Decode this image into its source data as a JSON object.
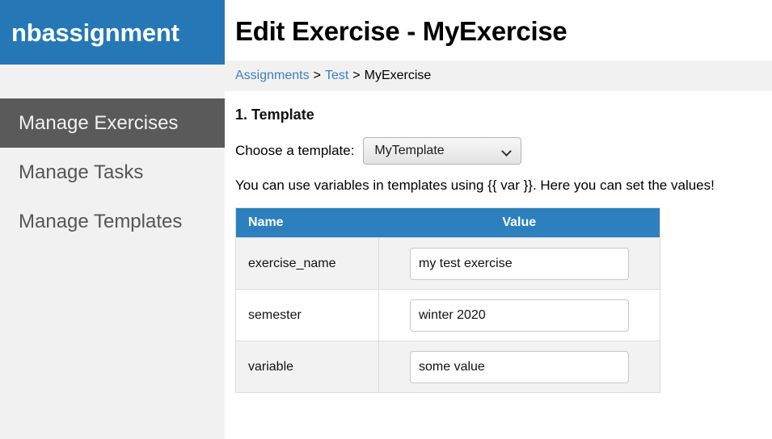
{
  "sidebar": {
    "brand": "nbassignment",
    "items": [
      {
        "label": "Manage Exercises",
        "active": true
      },
      {
        "label": "Manage Tasks",
        "active": false
      },
      {
        "label": "Manage Templates",
        "active": false
      }
    ]
  },
  "header": {
    "title": "Edit Exercise - MyExercise"
  },
  "breadcrumb": {
    "items": [
      {
        "label": "Assignments",
        "link": true
      },
      {
        "label": "Test",
        "link": true
      },
      {
        "label": "MyExercise",
        "link": false
      }
    ],
    "separator": ">"
  },
  "template_section": {
    "heading": "1. Template",
    "choose_label": "Choose a template:",
    "selected_template": "MyTemplate",
    "dropdown_icon": "chevron-down-icon",
    "help_text": "You can use variables in templates using {{ var }}. Here you can set the values!"
  },
  "variables_table": {
    "columns": [
      "Name",
      "Value"
    ],
    "rows": [
      {
        "name": "exercise_name",
        "value": "my test exercise"
      },
      {
        "name": "semester",
        "value": "winter 2020"
      },
      {
        "name": "variable",
        "value": "some value"
      }
    ]
  },
  "colors": {
    "brand_blue": "#2578b5",
    "table_header_blue": "#2c80bd",
    "sidebar_bg": "#f1f1f1",
    "sidebar_active_bg": "#5a5a5a",
    "link_blue": "#3b7fb8",
    "row_shade": "#f2f2f2"
  }
}
